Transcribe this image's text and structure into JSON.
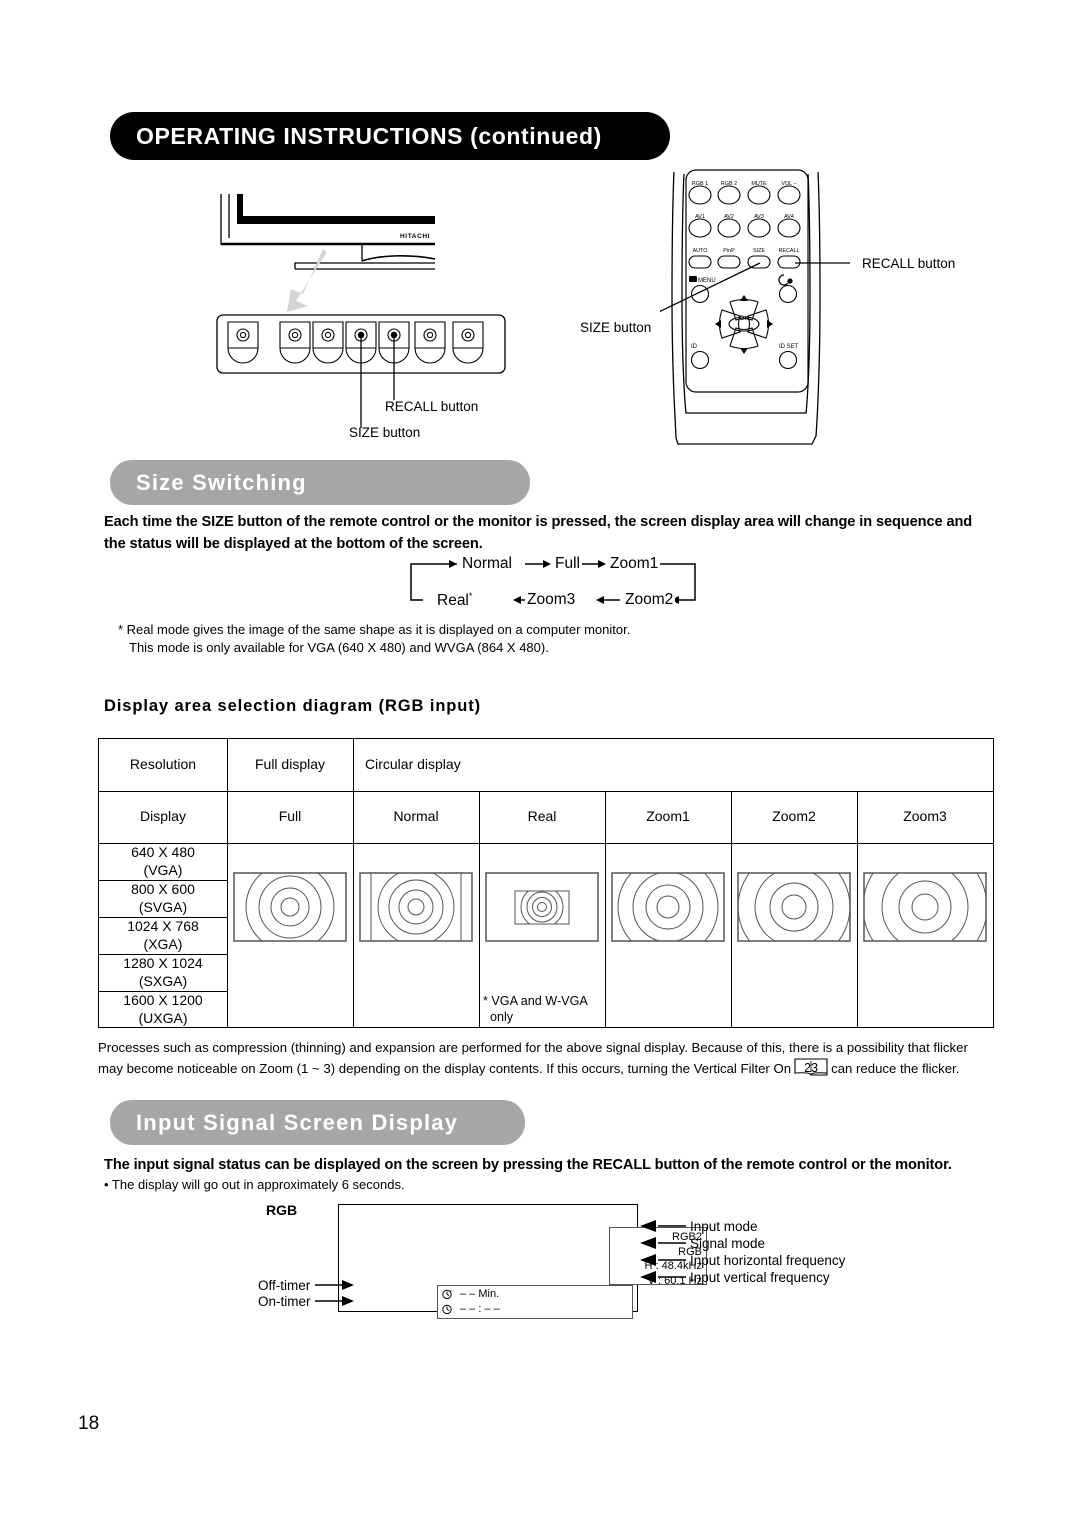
{
  "banner": {
    "title": "OPERATING INSTRUCTIONS (continued)"
  },
  "page": {
    "number": "18"
  },
  "figures": {
    "monitor": {
      "brand": "HITACHI",
      "callouts": [
        {
          "name": "recall-button",
          "label": "RECALL button"
        },
        {
          "name": "size-button",
          "label": "SIZE button"
        }
      ]
    },
    "remote": {
      "callouts": [
        {
          "name": "recall-button",
          "label": "RECALL button"
        },
        {
          "name": "size-button",
          "label": "SIZE button"
        }
      ],
      "button_rows": [
        [
          "RGB 1",
          "RGB 2",
          "MUTE",
          "VOL −"
        ],
        [
          "AV1",
          "AV2",
          "AV3",
          "AV4"
        ],
        [
          "AUTO",
          "PinP",
          "SIZE",
          "RECALL"
        ]
      ],
      "menu_label": "MENU",
      "ok_label": "OK",
      "id_label": "ID",
      "id_set_label": "ID SET"
    }
  },
  "sections": {
    "size_switching": {
      "heading": "Size Switching",
      "intro": "Each time the SIZE button of the remote control or the monitor is pressed, the screen display area will change in sequence and the status will be displayed at the bottom of the screen.",
      "cycle": [
        "Normal",
        "Full",
        "Zoom1",
        "Zoom2",
        "Zoom3",
        "Real"
      ],
      "cycle_top": [
        "Normal",
        "Full",
        "Zoom1"
      ],
      "cycle_bottom": [
        "Real",
        "Zoom3",
        "Zoom2"
      ],
      "real_marker": "*",
      "footnote_line1": "* Real mode gives the image of the same shape as it is displayed on a computer monitor.",
      "footnote_line2": "This mode is only available for VGA (640 X 480) and WVGA (864 X 480).",
      "sub_heading": "Display area selection diagram (RGB input)"
    },
    "input_signal": {
      "heading": "Input Signal Screen Display",
      "intro": "The input signal status can be displayed on the screen by pressing the RECALL button of the remote control or the monitor.",
      "bullet": "• The display will go out in approximately 6 seconds."
    }
  },
  "table": {
    "group_headers": {
      "resolution": "Resolution",
      "full_display": "Full display",
      "circular_display": "Circular display"
    },
    "col_headers": [
      "Display",
      "Full",
      "Normal",
      "Real",
      "Zoom1",
      "Zoom2",
      "Zoom3"
    ],
    "rows": [
      {
        "res": "640 X 480",
        "name": "(VGA)"
      },
      {
        "res": "800 X 600",
        "name": "(SVGA)"
      },
      {
        "res": "1024 X 768",
        "name": "(XGA)"
      },
      {
        "res": "1280 X 1024",
        "name": "(SXGA)"
      },
      {
        "res": "1600 X 1200",
        "name": "(UXGA)"
      }
    ],
    "real_note_line1": "* VGA and W-VGA",
    "real_note_line2": "only"
  },
  "flicker_note": {
    "part1": "Processes such as compression (thinning) and expansion are performed for the above signal display. Because of this, there is a possibility that flicker may become noticeable on Zoom (1 ~ 3) depending on the display contents. If this occurs, turning the Vertical Filter On",
    "page_ref": "23",
    "part2": "can reduce the flicker."
  },
  "osd": {
    "title": "RGB",
    "signal_lines": [
      "RGB2",
      "RGB",
      "H :  48.4kHz",
      "V :  60.1  Hz"
    ],
    "signal_values": {
      "input_mode": "RGB2",
      "signal_mode": "RGB",
      "h_freq": "H :  48.4kHz",
      "v_freq": "V :  60.1  Hz"
    },
    "right_labels": [
      "Input mode",
      "Signal mode",
      "Input horizontal frequency",
      "Input vertical frequency"
    ],
    "left_labels": [
      "Off-timer",
      "On-timer"
    ],
    "off_timer_value": "– – Min.",
    "on_timer_value": "– – : – –"
  },
  "colors": {
    "banner_bg": "#000000",
    "section_heading_bg": "#a6a6a6",
    "text": "#000000",
    "arrow_gray": "#d4d4d4"
  }
}
